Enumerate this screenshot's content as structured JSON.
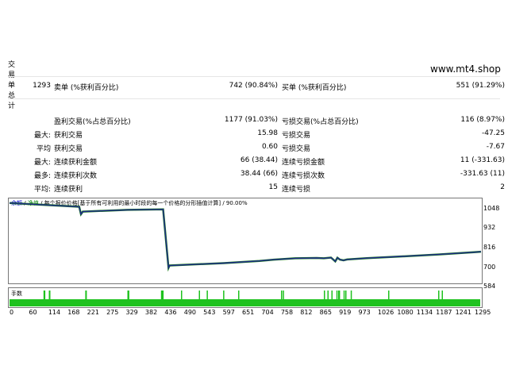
{
  "side_label": [
    "交",
    "易",
    "单",
    "总",
    "计"
  ],
  "watermark": "www.mt4.shop",
  "stats": {
    "total_trades": "1293",
    "short_label": "卖单 (%获利百分比)",
    "short_value": "742 (90.84%)",
    "long_label": "买单 (%获利百分比)",
    "long_value": "551 (91.29%)",
    "profit_trades_label": "盈利交易(%占总百分比)",
    "profit_trades_value": "1177 (91.03%)",
    "loss_trades_label": "亏损交易(%占总百分比)",
    "loss_trades_value": "116 (8.97%)",
    "rows": [
      {
        "prefix": "最大:",
        "label1": "获利交易",
        "value1": "15.98",
        "label2": "亏损交易",
        "value2": "-47.25"
      },
      {
        "prefix": "平均",
        "label1": "获利交易",
        "value1": "0.60",
        "label2": "亏损交易",
        "value2": "-7.67"
      },
      {
        "prefix": "最大:",
        "label1": "连续获利金额",
        "value1": "66 (38.44)",
        "label2": "连续亏损金额",
        "value2": "11 (-331.63)"
      },
      {
        "prefix": "最多:",
        "label1": "连续获利次数",
        "value1": "38.44 (66)",
        "label2": "连续亏损次数",
        "value2": "-331.63 (11)"
      },
      {
        "prefix": "平均:",
        "label1": "连续获利",
        "value1": "15",
        "label2": "连续亏损",
        "value2": "2"
      }
    ]
  },
  "chart": {
    "legend_balance": "余额",
    "legend_equity": "净值",
    "legend_rest": "/ 每个报价价格[基于所有可利用的最小时段的每一个价格的分形插值计算] / 90.00%",
    "volume_label": "手数",
    "colors": {
      "balance": "#1f2a8c",
      "equity": "#1a7a1a",
      "volume": "#1fc21f"
    }
  },
  "chart_data": {
    "type": "line",
    "title": "",
    "xlabel": "",
    "ylabel": "",
    "x_ticks": [
      "0",
      "60",
      "114",
      "168",
      "221",
      "275",
      "329",
      "382",
      "436",
      "490",
      "543",
      "597",
      "651",
      "704",
      "758",
      "812",
      "865",
      "919",
      "973",
      "1026",
      "1080",
      "1134",
      "1187",
      "1241",
      "1295"
    ],
    "y_ticks": [
      "1048",
      "932",
      "816",
      "700",
      "584"
    ],
    "ylim": [
      584,
      1048
    ],
    "xlim": [
      0,
      1320
    ],
    "grid": false,
    "series": [
      {
        "x": [
          0,
          195,
          200,
          205,
          330,
          430,
          445,
          448,
          600,
          700,
          740,
          800,
          860,
          880,
          900,
          912,
          918,
          925,
          935,
          945,
          1000,
          1100,
          1200,
          1300,
          1320
        ],
        "y": [
          1040,
          1018,
          975,
          990,
          1000,
          1003,
          665,
          678,
          692,
          705,
          712,
          720,
          722,
          720,
          724,
          702,
          723,
          712,
          708,
          713,
          721,
          731,
          742,
          755,
          758
        ]
      }
    ],
    "volume_markers_x": [
      95,
      97,
      110,
      111,
      212,
      213,
      330,
      332,
      424,
      425,
      426,
      428,
      480,
      530,
      552,
      598,
      640,
      760,
      765,
      880,
      890,
      901,
      915,
      920,
      922,
      935,
      940,
      955,
      1060,
      1200,
      1210
    ]
  }
}
